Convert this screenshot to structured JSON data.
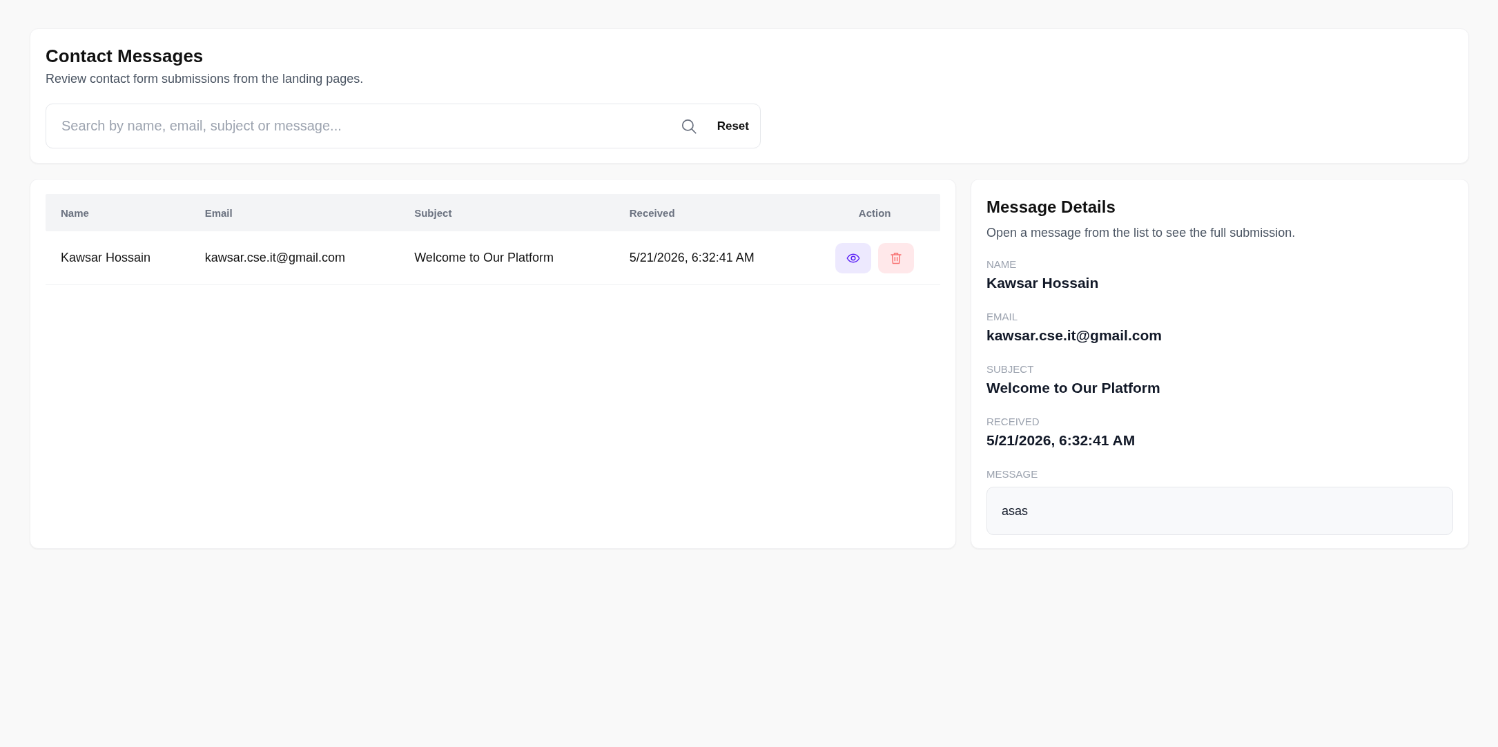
{
  "page": {
    "title": "Contact Messages",
    "subtitle": "Review contact form submissions from the landing pages."
  },
  "search": {
    "placeholder": "Search by name, email, subject or message...",
    "reset_label": "Reset"
  },
  "table": {
    "columns": [
      "Name",
      "Email",
      "Subject",
      "Received",
      "Action"
    ],
    "rows": [
      {
        "cells": [
          "Kawsar Hossain",
          "kawsar.cse.it@gmail.com",
          "Welcome to Our Platform",
          "5/21/2026, 6:32:41 AM"
        ],
        "actions": [
          {
            "kind": "view"
          },
          {
            "kind": "delete"
          }
        ]
      }
    ]
  },
  "details": {
    "title": "Message Details",
    "subtitle": "Open a message from the list to see the full submission.",
    "fields": [
      {
        "label": "NAME",
        "value": "Kawsar Hossain"
      },
      {
        "label": "EMAIL",
        "value": "kawsar.cse.it@gmail.com"
      },
      {
        "label": "SUBJECT",
        "value": "Welcome to Our Platform"
      },
      {
        "label": "RECEIVED",
        "value": "5/21/2026, 6:32:41 AM"
      }
    ],
    "message": {
      "label": "MESSAGE",
      "value": "asas"
    }
  }
}
